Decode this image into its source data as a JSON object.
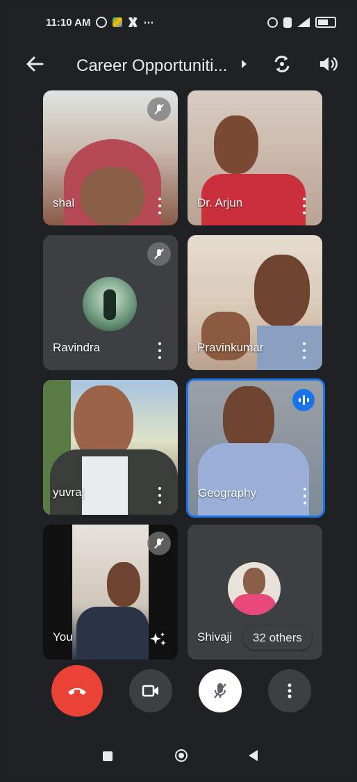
{
  "status": {
    "time": "11:10 AM",
    "more": "⋯"
  },
  "header": {
    "title": "Career Opportuniti..."
  },
  "participants": [
    {
      "name": "shal",
      "muted": true
    },
    {
      "name": "Dr. Arjun",
      "muted": false
    },
    {
      "name": "Ravindra",
      "muted": true
    },
    {
      "name": "Pravinkumar",
      "muted": false
    },
    {
      "name": "yuvraj",
      "muted": false
    },
    {
      "name": "Geography",
      "muted": false,
      "speaking": true
    },
    {
      "name": "You",
      "muted": true
    },
    {
      "name": "Shivaji",
      "muted": false
    }
  ],
  "others_label": "32 others",
  "colors": {
    "end_call": "#ea4335",
    "speaking_border": "#1a73e8",
    "background": "#202124"
  }
}
